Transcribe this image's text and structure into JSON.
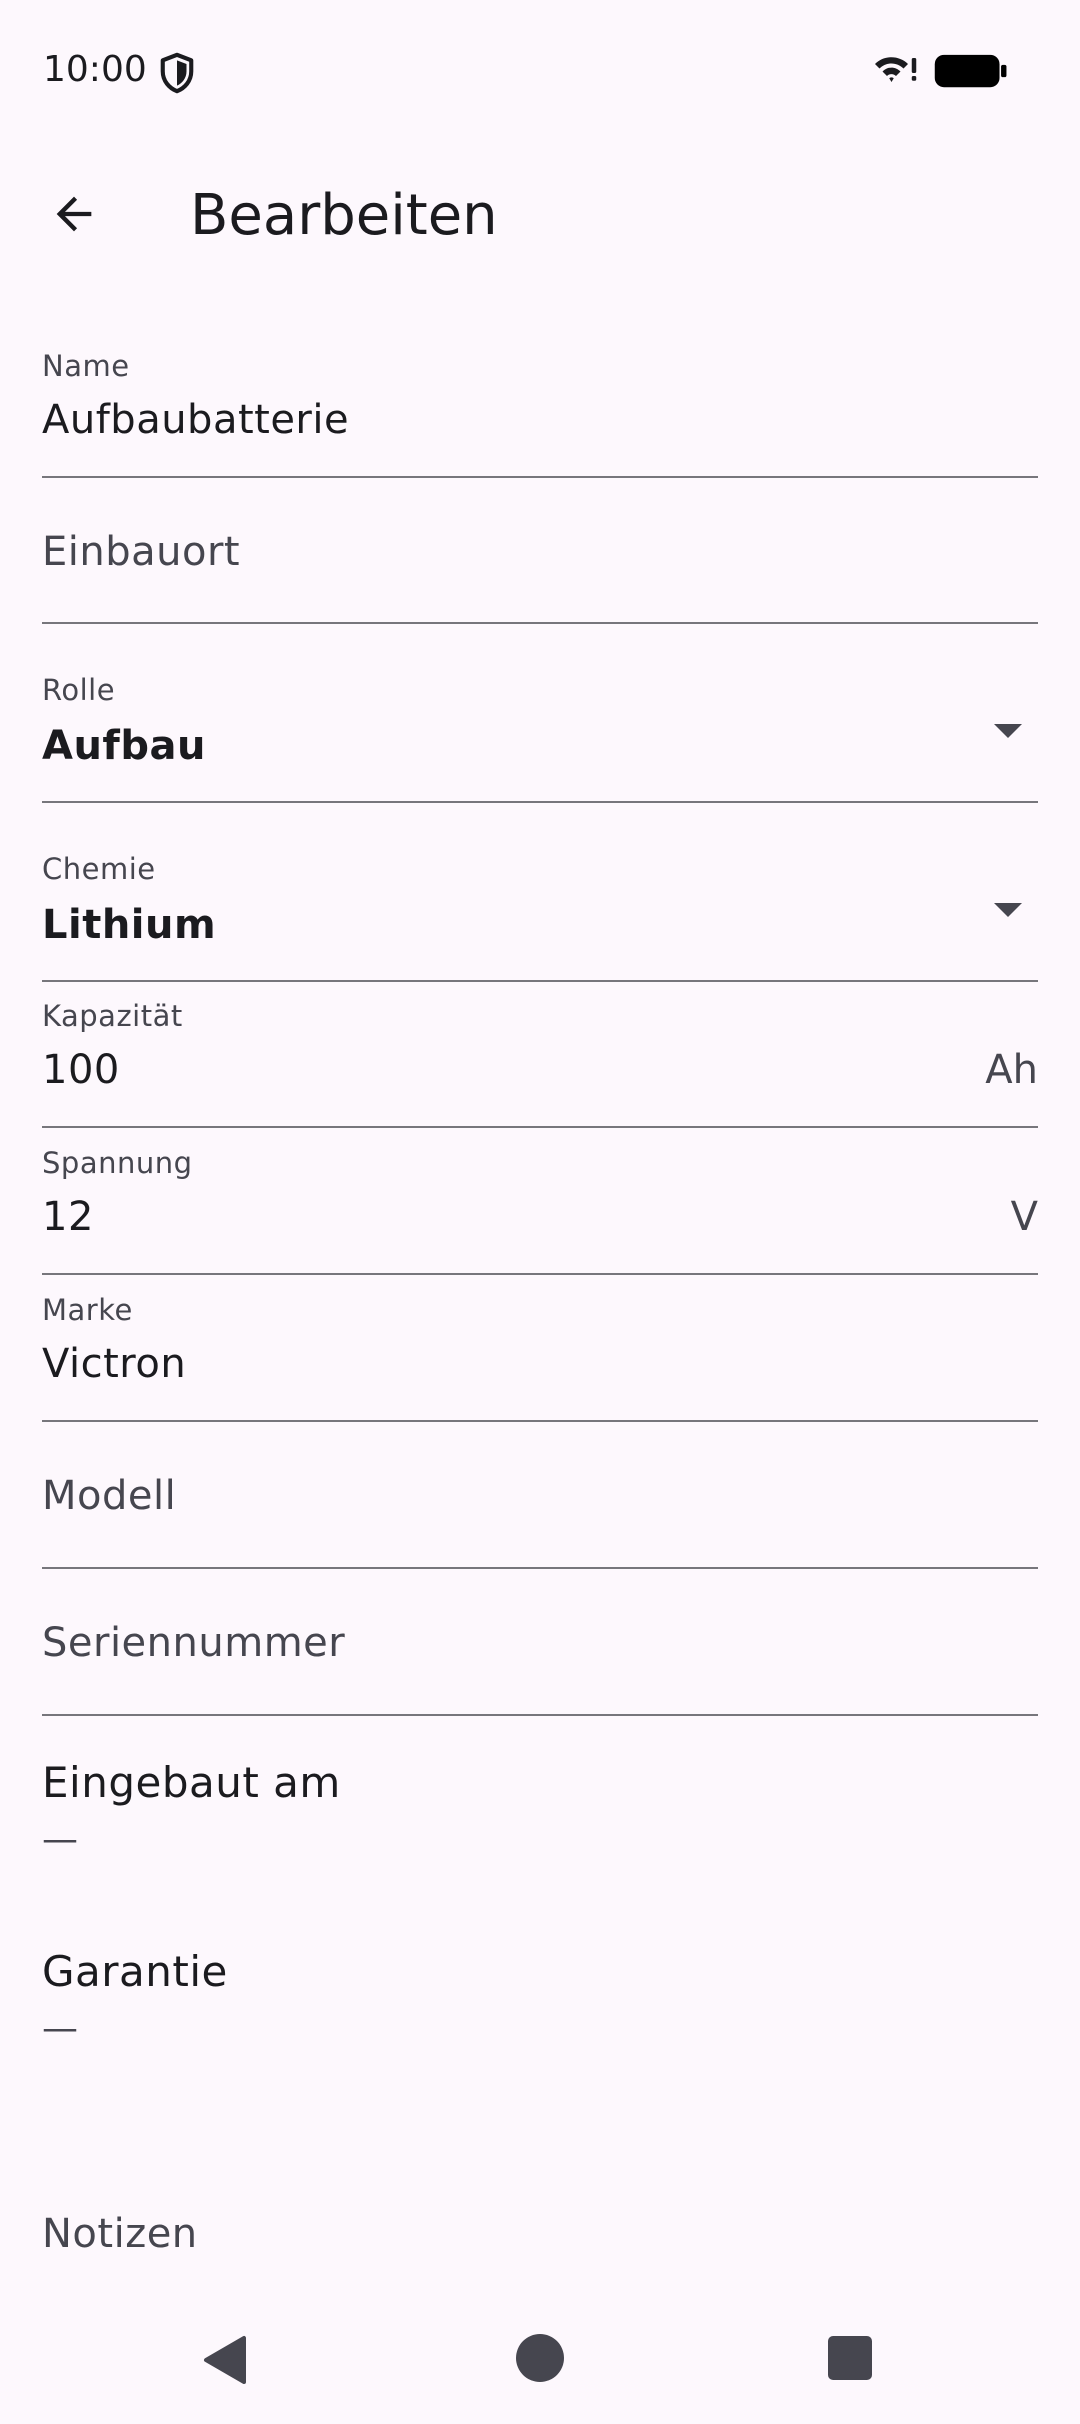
{
  "status_bar": {
    "time": "10:00",
    "icons": [
      "shield-icon",
      "wifi-icon",
      "battery-icon"
    ]
  },
  "app_bar": {
    "title": "Bearbeiten",
    "back_icon": "arrow-back-icon"
  },
  "form": {
    "name": {
      "label": "Name",
      "value": "Aufbaubatterie"
    },
    "einbauort": {
      "placeholder": "Einbauort"
    },
    "rolle": {
      "label": "Rolle",
      "value": "Aufbau"
    },
    "chemie": {
      "label": "Chemie",
      "value": "Lithium"
    },
    "kapazitaet": {
      "label": "Kapazität",
      "value": "100",
      "suffix": "Ah"
    },
    "spannung": {
      "label": "Spannung",
      "value": "12",
      "suffix": "V"
    },
    "marke": {
      "label": "Marke",
      "value": "Victron"
    },
    "modell": {
      "placeholder": "Modell"
    },
    "seriennummer": {
      "placeholder": "Seriennummer"
    },
    "eingebaut_am": {
      "title": "Eingebaut am",
      "value": "—"
    },
    "garantie": {
      "title": "Garantie",
      "value": "—"
    },
    "notizen": {
      "placeholder": "Notizen"
    }
  },
  "colors": {
    "background": "#fdf8fd",
    "text": "#1b1b1f",
    "secondary_text": "#46464f",
    "underline": "#77767c"
  }
}
